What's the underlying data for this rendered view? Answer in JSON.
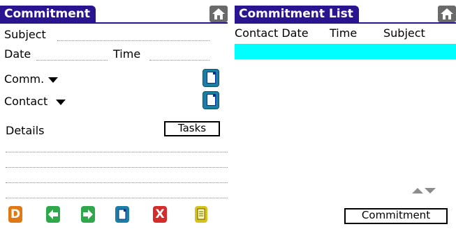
{
  "left": {
    "title": "Commitment",
    "subject_label": "Subject",
    "date_label": "Date",
    "time_label": "Time",
    "comm_label": "Comm.",
    "contact_label": "Contact",
    "details_label": "Details",
    "tasks_button": "Tasks",
    "toolbar": {
      "delete_text": "D",
      "cancel_text": "X"
    }
  },
  "right": {
    "title": "Commitment List",
    "columns": [
      "Contact Date",
      "Time",
      "Subject"
    ],
    "commitment_button": "Commitment"
  },
  "colors": {
    "title_bar": "#2b148f",
    "selection": "#00ffff",
    "new_doc": "#1b7ea3",
    "delete": "#e07814",
    "back": "#2ea84a",
    "forward": "#2ea84a",
    "cancel": "#d42b2b",
    "notes": "#d6c21c"
  },
  "icons": [
    "home-icon",
    "new-document-icon",
    "delete-icon",
    "back-arrow-icon",
    "forward-arrow-icon",
    "cancel-icon",
    "notes-icon",
    "scroll-up-icon",
    "scroll-down-icon"
  ]
}
